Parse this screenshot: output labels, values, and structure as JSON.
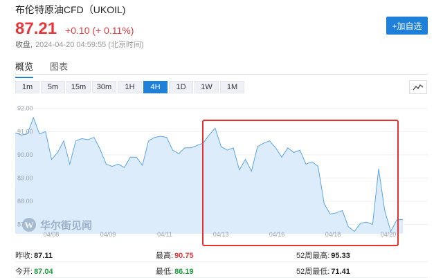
{
  "header": {
    "title": "布伦特原油CFD（UKOIL)",
    "price": "87.21",
    "change": "+0.10 (+ 0.11%)",
    "status_label": "收盘,",
    "status_time": "2024-04-20 04:59:55 (北京时间)",
    "add_button": "+加自选"
  },
  "tabs": [
    {
      "label": "概览",
      "active": true
    },
    {
      "label": "图表",
      "active": false
    }
  ],
  "periods": [
    {
      "label": "1m"
    },
    {
      "label": "5m"
    },
    {
      "label": "15m"
    },
    {
      "label": "30m"
    },
    {
      "label": "1H"
    },
    {
      "label": "4H",
      "active": true
    },
    {
      "label": "1D"
    },
    {
      "label": "1W"
    },
    {
      "label": "1M"
    }
  ],
  "chart_type_icon": "line-chart-icon",
  "watermark": "华尔街见闻",
  "colors": {
    "accent": "#1e80d9",
    "up": "#e4393c",
    "down": "#1a9f3c",
    "line": "#5aa6e6",
    "area": "#dcecfb",
    "highlight": "#e8312b"
  },
  "chart_data": {
    "type": "area",
    "y_ticks": [
      "92.00",
      "91.00",
      "90.00",
      "89.00",
      "88.00",
      "87.00"
    ],
    "ylim": [
      86.6,
      92.2
    ],
    "x_ticks": [
      "04/08",
      "04/09",
      "04/11",
      "04/13",
      "04/16",
      "04/18",
      "04/20"
    ],
    "values": [
      90.95,
      90.85,
      90.9,
      91.6,
      90.9,
      91.0,
      89.8,
      90.1,
      90.6,
      89.6,
      90.6,
      90.7,
      90.65,
      90.75,
      90.25,
      89.6,
      89.5,
      89.6,
      89.45,
      89.9,
      89.9,
      89.55,
      90.6,
      90.75,
      90.8,
      90.75,
      90.2,
      90.05,
      90.3,
      90.3,
      90.4,
      90.5,
      90.85,
      91.15,
      90.35,
      90.2,
      90.3,
      89.35,
      89.8,
      89.3,
      90.35,
      90.5,
      90.6,
      90.3,
      89.9,
      90.3,
      90.1,
      90.2,
      89.6,
      89.7,
      89.5,
      87.9,
      87.45,
      87.5,
      87.6,
      86.9,
      86.7,
      87.05,
      87.1,
      87.0,
      89.4,
      87.6,
      86.7,
      87.2,
      87.21
    ]
  },
  "stats": [
    [
      {
        "label": "昨收:",
        "value": "87.11",
        "tone": "dark"
      },
      {
        "label": "最高:",
        "value": "90.75",
        "tone": "red"
      },
      {
        "label": "52周最高:",
        "value": "95.33",
        "tone": "dark"
      }
    ],
    [
      {
        "label": "今开:",
        "value": "87.04",
        "tone": "green"
      },
      {
        "label": "最低:",
        "value": "86.19",
        "tone": "green"
      },
      {
        "label": "52周最低:",
        "value": "71.41",
        "tone": "dark"
      }
    ]
  ]
}
